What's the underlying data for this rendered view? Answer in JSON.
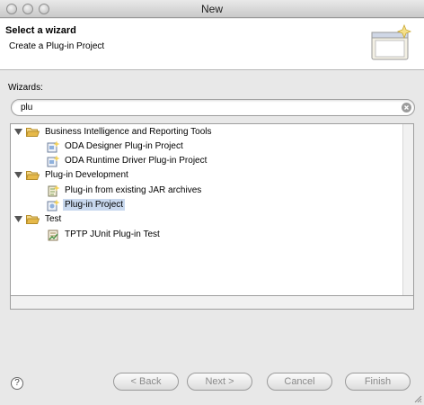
{
  "window": {
    "title": "New"
  },
  "header": {
    "title": "Select a wizard",
    "description": "Create a Plug-in Project"
  },
  "wizards": {
    "label": "Wizards:",
    "filter_value": "plu"
  },
  "tree": {
    "categories": [
      {
        "label": "Business Intelligence and Reporting Tools",
        "items": [
          "ODA Designer Plug-in Project",
          "ODA Runtime Driver Plug-in Project"
        ]
      },
      {
        "label": "Plug-in Development",
        "items": [
          "Plug-in from existing JAR archives",
          "Plug-in Project"
        ]
      },
      {
        "label": "Test",
        "items": [
          "TPTP JUnit Plug-in Test"
        ]
      }
    ],
    "selected": "Plug-in Project"
  },
  "buttons": {
    "help": "?",
    "back": "< Back",
    "next": "Next >",
    "cancel": "Cancel",
    "finish": "Finish"
  },
  "colors": {
    "selection": "#c8d8ee",
    "folder": "#e6b94a"
  }
}
